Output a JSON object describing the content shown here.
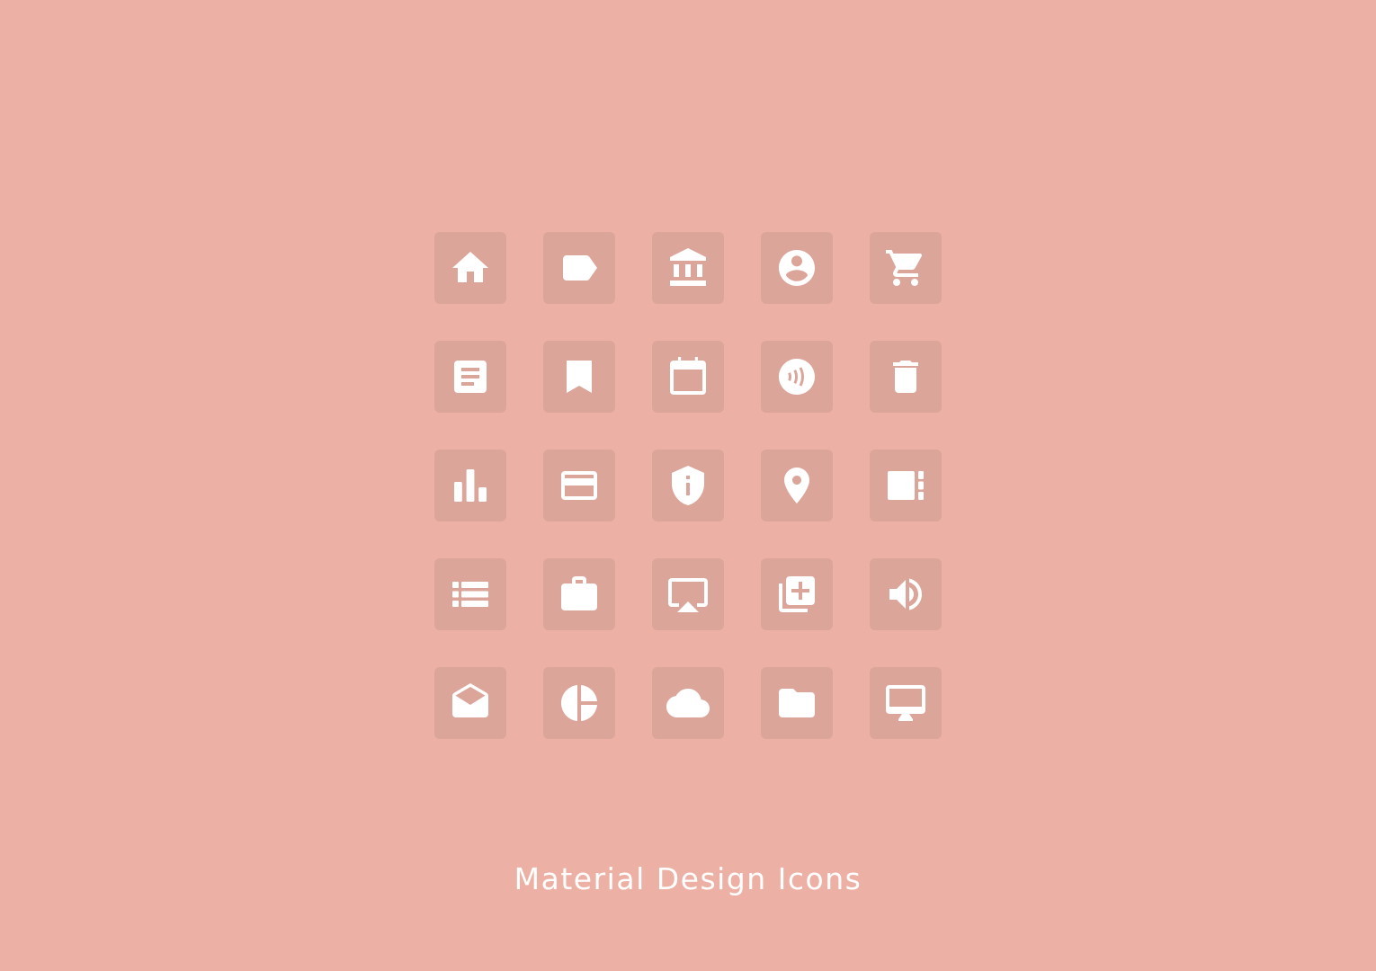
{
  "caption": "Material Design Icons",
  "colors": {
    "background": "#ecb0a4",
    "tile": "#dca59a",
    "icon": "#ffffff"
  },
  "icons": [
    "home-icon",
    "label-icon",
    "bank-icon",
    "account-circle-icon",
    "shopping-cart-icon",
    "article-icon",
    "bookmark-icon",
    "calendar-icon",
    "contactless-icon",
    "delete-icon",
    "bar-chart-icon",
    "credit-card-icon",
    "security-info-icon",
    "location-pin-icon",
    "view-sidebar-icon",
    "list-icon",
    "briefcase-icon",
    "airplay-icon",
    "add-to-library-icon",
    "volume-up-icon",
    "drafts-icon",
    "pie-chart-icon",
    "cloud-icon",
    "folder-icon",
    "desktop-icon"
  ]
}
